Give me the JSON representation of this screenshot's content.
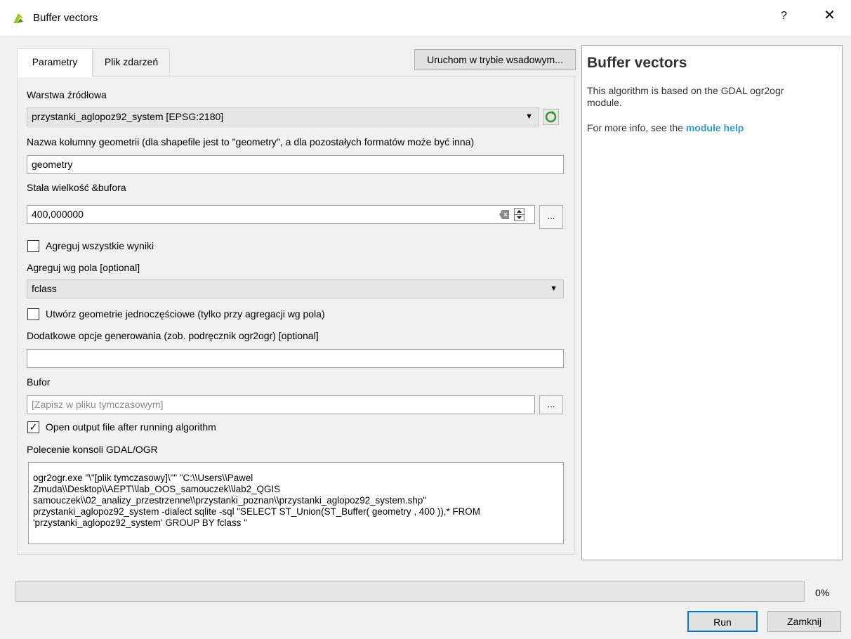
{
  "window": {
    "title": "Buffer vectors",
    "help_glyph": "?",
    "close_glyph": "✕"
  },
  "tabs": [
    {
      "label": "Parametry",
      "active": true
    },
    {
      "label": "Plik zdarzeń",
      "active": false
    }
  ],
  "batch_button": "Uruchom w trybie wsadowym...",
  "form": {
    "source_label": "Warstwa źródłowa",
    "source_value": "przystanki_aglopoz92_system [EPSG:2180]",
    "geom_label": "Nazwa kolumny geometrii (dla shapefile jest to \"geometry\", a dla pozostałych formatów może być inna)",
    "geom_value": "geometry",
    "buffer_label": "Stała wielkość &bufora",
    "buffer_value": "400,000000",
    "dots": "...",
    "aggregate_all_label": "Agreguj wszystkie wyniki",
    "aggregate_all_checked": false,
    "aggregate_field_label": "Agreguj wg pola [optional]",
    "aggregate_field_value": "fclass",
    "single_part_label": "Utwórz geometrie jednoczęściowe (tylko przy agregacji wg pola)",
    "single_part_checked": false,
    "extra_opts_label": "Dodatkowe opcje generowania (zob. podręcznik ogr2ogr) [optional]",
    "extra_opts_value": "",
    "output_label": "Bufor",
    "output_placeholder": "[Zapisz w pliku tymczasowym]",
    "open_output_label": "Open output file after running algorithm",
    "open_output_checked": true,
    "console_label": "Polecenie konsoli GDAL/OGR",
    "console_text": "ogr2ogr.exe \"\\\"[plik tymczasowy]\\\"\" \"C:\\\\Users\\\\Pawel\nZmuda\\\\Desktop\\\\AEPT\\\\lab_OOS_samouczek\\\\lab2_QGIS\nsamouczek\\\\02_analizy_przestrzenne\\\\przystanki_poznan\\\\przystanki_aglopoz92_system.shp\"\nprzystanki_aglopoz92_system -dialect sqlite -sql \"SELECT ST_Union(ST_Buffer( geometry , 400 )),* FROM\n'przystanki_aglopoz92_system' GROUP BY fclass \""
  },
  "help": {
    "title": "Buffer vectors",
    "description": "This algorithm is based on the GDAL ogr2ogr module.",
    "more_prefix": "For more info, see the",
    "more_link": "module help"
  },
  "progress": {
    "fraction": 0.0,
    "label": "0%"
  },
  "buttons": {
    "run": "Run",
    "close": "Zamknij"
  },
  "colors": {
    "link": "#3399cc",
    "accent_green": "#4a9a2a"
  }
}
